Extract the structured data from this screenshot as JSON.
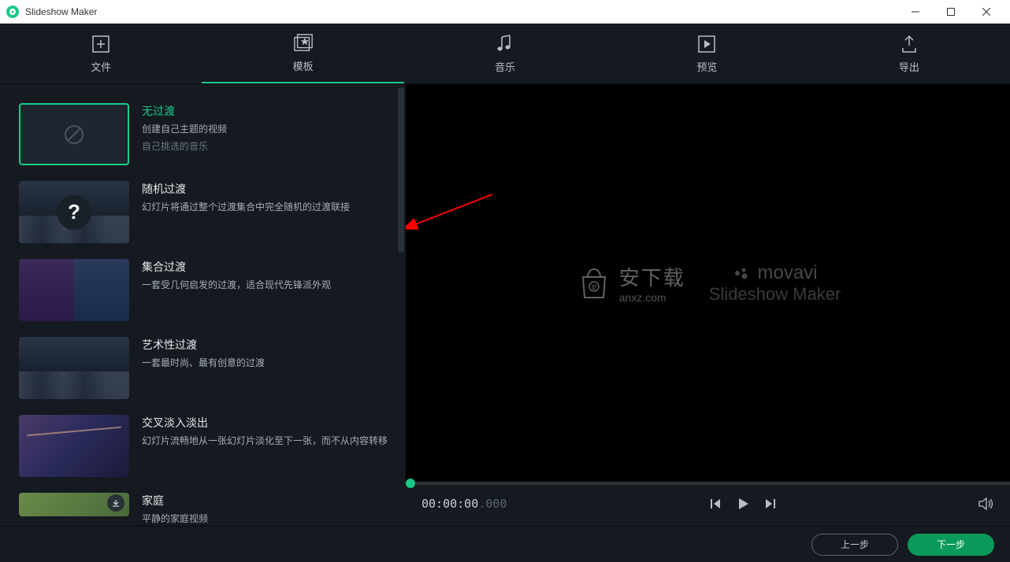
{
  "window": {
    "title": "Slideshow Maker"
  },
  "tabs": {
    "file": "文件",
    "template": "模板",
    "music": "音乐",
    "preview": "预览",
    "export": "导出"
  },
  "templates": [
    {
      "title": "无过渡",
      "desc": "创建自己主题的视频",
      "sub": "自己挑选的音乐"
    },
    {
      "title": "随机过渡",
      "desc": "幻灯片将通过整个过渡集合中完全随机的过渡联接"
    },
    {
      "title": "集合过渡",
      "desc": "一套受几何启发的过渡，适合现代先锋派外观"
    },
    {
      "title": "艺术性过渡",
      "desc": "一套最时尚、最有创意的过渡"
    },
    {
      "title": "交叉淡入淡出",
      "desc": "幻灯片流畅地从一张幻灯片淡化至下一张，而不从内容转移"
    },
    {
      "title": "家庭",
      "desc": "平静的家庭视频"
    }
  ],
  "previewBrand": {
    "anxz_cn": "安下载",
    "anxz_en": "anxz.com",
    "movavi": "movavi",
    "product": "Slideshow Maker"
  },
  "player": {
    "time_main": "00:00:00",
    "time_ms": ".000"
  },
  "footer": {
    "prev": "上一步",
    "next": "下一步"
  }
}
